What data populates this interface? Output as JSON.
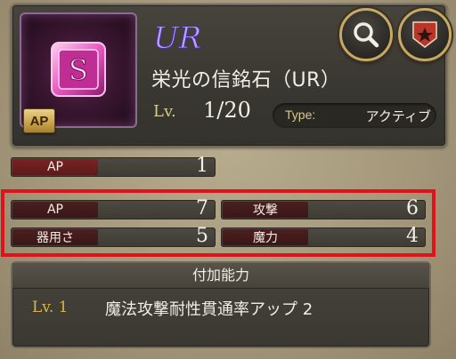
{
  "item": {
    "rarity": "UR",
    "name": "栄光の信銘石（UR）",
    "level_label": "Lv.",
    "level_value": "1/20",
    "type_label": "Type:",
    "type_value": "アクティブ",
    "badge": "AP"
  },
  "cost_stat": {
    "label": "AP",
    "value": "1"
  },
  "stats": [
    {
      "label": "AP",
      "value": "7"
    },
    {
      "label": "攻撃",
      "value": "6"
    },
    {
      "label": "器用さ",
      "value": "5"
    },
    {
      "label": "魔力",
      "value": "4"
    }
  ],
  "bonus": {
    "title": "付加能力",
    "level": "Lv. 1",
    "description": "魔法攻撃耐性貫通率アップ 2"
  },
  "buttons": {
    "search_icon": "magnifier-icon",
    "favorite_icon": "star-shield-icon"
  },
  "colors": {
    "highlight": "#e0121b",
    "gold": "#d8c88a",
    "label_red": "#7a2323"
  }
}
